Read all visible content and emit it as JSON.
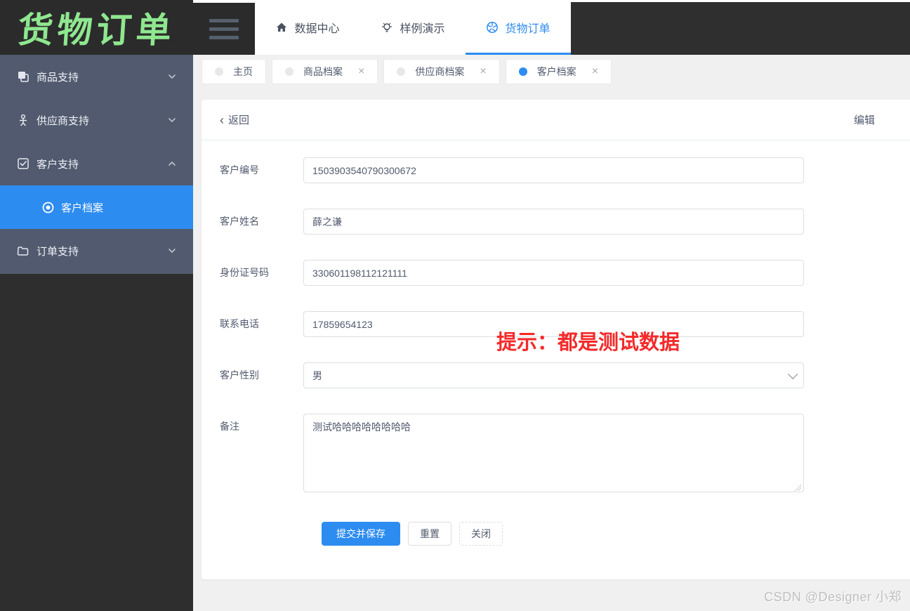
{
  "app": {
    "logo_text": "货物订单"
  },
  "sidebar": {
    "items": [
      {
        "label": "商品支持",
        "icon": "book-icon",
        "state": "collapsed"
      },
      {
        "label": "供应商支持",
        "icon": "person-icon",
        "state": "collapsed"
      },
      {
        "label": "客户支持",
        "icon": "checkbox-icon",
        "state": "expanded"
      },
      {
        "label": "订单支持",
        "icon": "folder-icon",
        "state": "collapsed"
      }
    ],
    "subitems": [
      {
        "label": "客户档案",
        "icon": "radio-on-icon",
        "active": true
      }
    ]
  },
  "topnav": {
    "items": [
      {
        "label": "数据中心",
        "icon": "home-icon",
        "active": false
      },
      {
        "label": "样例演示",
        "icon": "bulb-icon",
        "active": false
      },
      {
        "label": "货物订单",
        "icon": "aperture-icon",
        "active": true
      }
    ]
  },
  "tabs": {
    "close_glyph": "×",
    "items": [
      {
        "label": "主页",
        "closable": false,
        "active": false
      },
      {
        "label": "商品档案",
        "closable": true,
        "active": false
      },
      {
        "label": "供应商档案",
        "closable": true,
        "active": false
      },
      {
        "label": "客户档案",
        "closable": true,
        "active": true
      }
    ]
  },
  "detail": {
    "back_label": "返回",
    "back_glyph": "‹",
    "edit_label": "编辑",
    "hint": "提示：都是测试数据",
    "fields": [
      {
        "label": "客户编号",
        "value": "1503903540790300672",
        "type": "input"
      },
      {
        "label": "客户姓名",
        "value": "薛之谦",
        "type": "input"
      },
      {
        "label": "身份证号码",
        "value": "330601198112121111",
        "type": "input"
      },
      {
        "label": "联系电话",
        "value": "17859654123",
        "type": "input"
      },
      {
        "label": "客户性别",
        "value": "男",
        "type": "select"
      },
      {
        "label": "备注",
        "value": "测试哈哈哈哈哈哈哈哈",
        "type": "textarea"
      }
    ],
    "buttons": {
      "submit": "提交并保存",
      "reset": "重置",
      "close": "关闭"
    }
  },
  "footer": {
    "watermark": "CSDN @Designer 小郑"
  },
  "colors": {
    "primary": "#2d8cf0",
    "hint_red": "#f42a2a",
    "sidebar_menu_bg": "#515a6e",
    "dark_bg": "#2e2e2e",
    "logo_green": "#8fe78f"
  }
}
